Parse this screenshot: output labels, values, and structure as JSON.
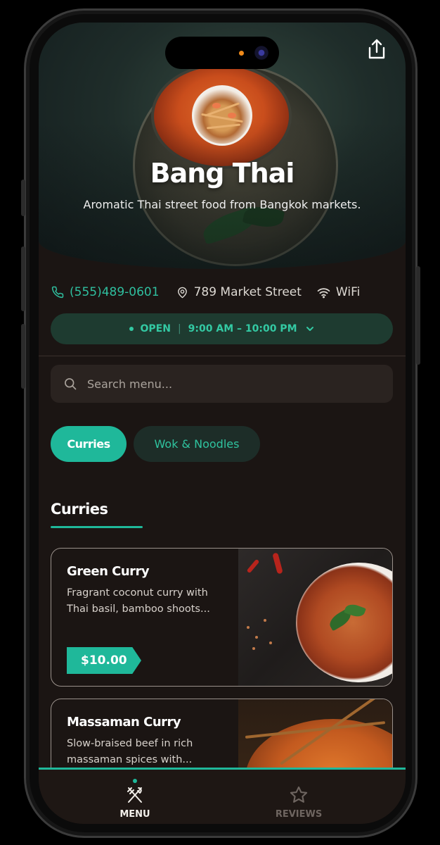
{
  "restaurant": {
    "name": "Bang Thai",
    "tagline": "Aromatic Thai street food from Bangkok markets."
  },
  "info": {
    "phone": "(555)489-0601",
    "address": "789 Market Street",
    "wifi": "WiFi"
  },
  "hours": {
    "status": "OPEN",
    "range": "9:00 AM – 10:00 PM"
  },
  "search": {
    "placeholder": "Search menu..."
  },
  "categories": [
    {
      "label": "Curries",
      "active": true
    },
    {
      "label": "Wok & Noodles",
      "active": false
    }
  ],
  "section": {
    "title": "Curries"
  },
  "menu_items": [
    {
      "name": "Green Curry",
      "description": "Fragrant coconut curry with Thai basil, bamboo shoots...",
      "price": "$10.00"
    },
    {
      "name": "Massaman Curry",
      "description": "Slow-braised beef in rich massaman spices with..."
    }
  ],
  "nav": {
    "menu_label": "MENU",
    "reviews_label": "REVIEWS"
  },
  "colors": {
    "accent": "#1fb89a",
    "background": "#1b1513",
    "open_pill": "#1e3b30"
  },
  "icons": [
    "share-icon",
    "phone-icon",
    "location-pin-icon",
    "wifi-icon",
    "chevron-down-icon",
    "search-icon",
    "utensils-icon",
    "star-icon"
  ]
}
